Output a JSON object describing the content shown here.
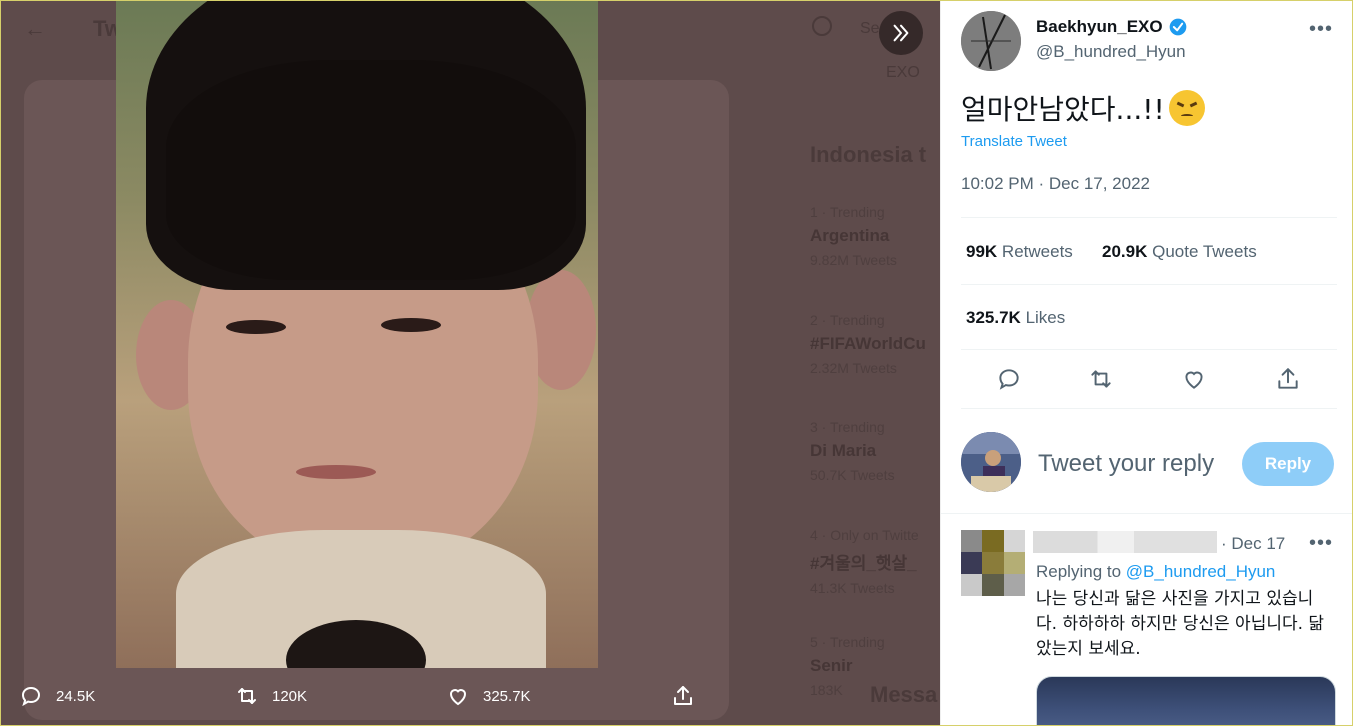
{
  "background": {
    "page_title": "Tw",
    "search_placeholder": "Se",
    "exo_label": "EXO",
    "trends_title": "Indonesia t",
    "trends": [
      {
        "meta": "1 · Trending",
        "name": "Argentina",
        "count": "9.82M Tweets"
      },
      {
        "meta": "2 · Trending",
        "name": "#FIFAWorldCu",
        "count": "2.32M Tweets"
      },
      {
        "meta": "3 · Trending",
        "name": "Di Maria",
        "count": "50.7K Tweets"
      },
      {
        "meta": "4 · Only on Twitte",
        "name": "#겨울의_햇살_",
        "count": "41.3K Tweets"
      },
      {
        "meta": "5 · Trending",
        "name": "Senir",
        "count": "183K"
      }
    ],
    "messages_label": "Messa"
  },
  "media_bar": {
    "replies": "24.5K",
    "retweets": "120K",
    "likes": "325.7K"
  },
  "tweet": {
    "display_name": "Baekhyun_EXO",
    "handle": "@B_hundred_Hyun",
    "text": "얼마안남았다...!!",
    "translate_label": "Translate Tweet",
    "timestamp": "10:02 PM · Dec 17, 2022",
    "retweets_count": "99K",
    "retweets_label": "Retweets",
    "quotes_count": "20.9K",
    "quotes_label": "Quote Tweets",
    "likes_count": "325.7K",
    "likes_label": "Likes"
  },
  "compose": {
    "placeholder": "Tweet your reply",
    "reply_button": "Reply"
  },
  "reply": {
    "date": "· Dec 17",
    "replying_prefix": "Replying to",
    "replying_handle": "@B_hundred_Hyun",
    "text": "나는 당신과 닮은 사진을 가지고 있습니다. 하하하하 하지만 당신은 아닙니다. 닮았는지 보세요."
  },
  "colors": {
    "accent": "#1d9bf0",
    "reply_button_disabled": "#8ecdf8",
    "overlay": "#5e4b4b"
  },
  "icons": [
    "back-arrow-icon",
    "search-icon",
    "expand-icon",
    "reply-icon",
    "retweet-icon",
    "like-icon",
    "share-icon",
    "verified-icon",
    "more-icon"
  ]
}
